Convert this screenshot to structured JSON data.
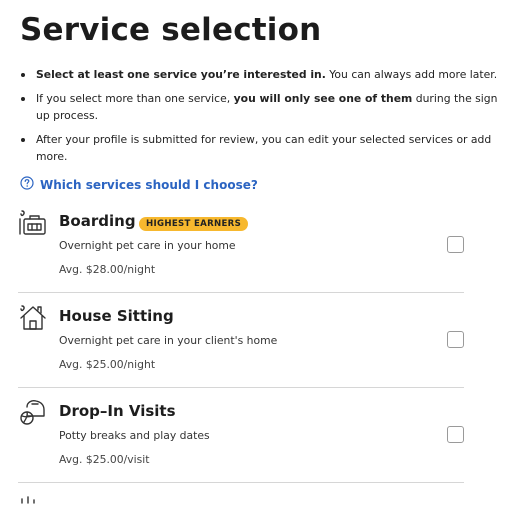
{
  "page": {
    "title": "Service selection"
  },
  "bullets": [
    {
      "bold": "Select at least one service you’re interested in.",
      "text": " You can always add more later."
    },
    {
      "pre": "If you select more than one service, ",
      "bold": "you will only see one of them",
      "post": " during the sign up process."
    },
    {
      "text": "After your profile is submitted for review, you can edit your selected services or add more."
    }
  ],
  "help": {
    "label": "Which services should I choose?",
    "icon": "question-circle-icon"
  },
  "services": [
    {
      "name": "Boarding",
      "badge": "HIGHEST EARNERS",
      "description": "Overnight pet care in your home",
      "price": "Avg. $28.00/night",
      "icon": "boarding-icon",
      "checked": false
    },
    {
      "name": "House Sitting",
      "description": "Overnight pet care in your client's home",
      "price": "Avg. $25.00/night",
      "icon": "house-sitting-icon",
      "checked": false
    },
    {
      "name": "Drop–In Visits",
      "description": "Potty breaks and play dates",
      "price": "Avg. $25.00/visit",
      "icon": "drop-in-visits-icon",
      "checked": false
    }
  ],
  "colors": {
    "link": "#2b64c2",
    "badge": "#f7b82e",
    "divider": "#d6d6d6"
  }
}
